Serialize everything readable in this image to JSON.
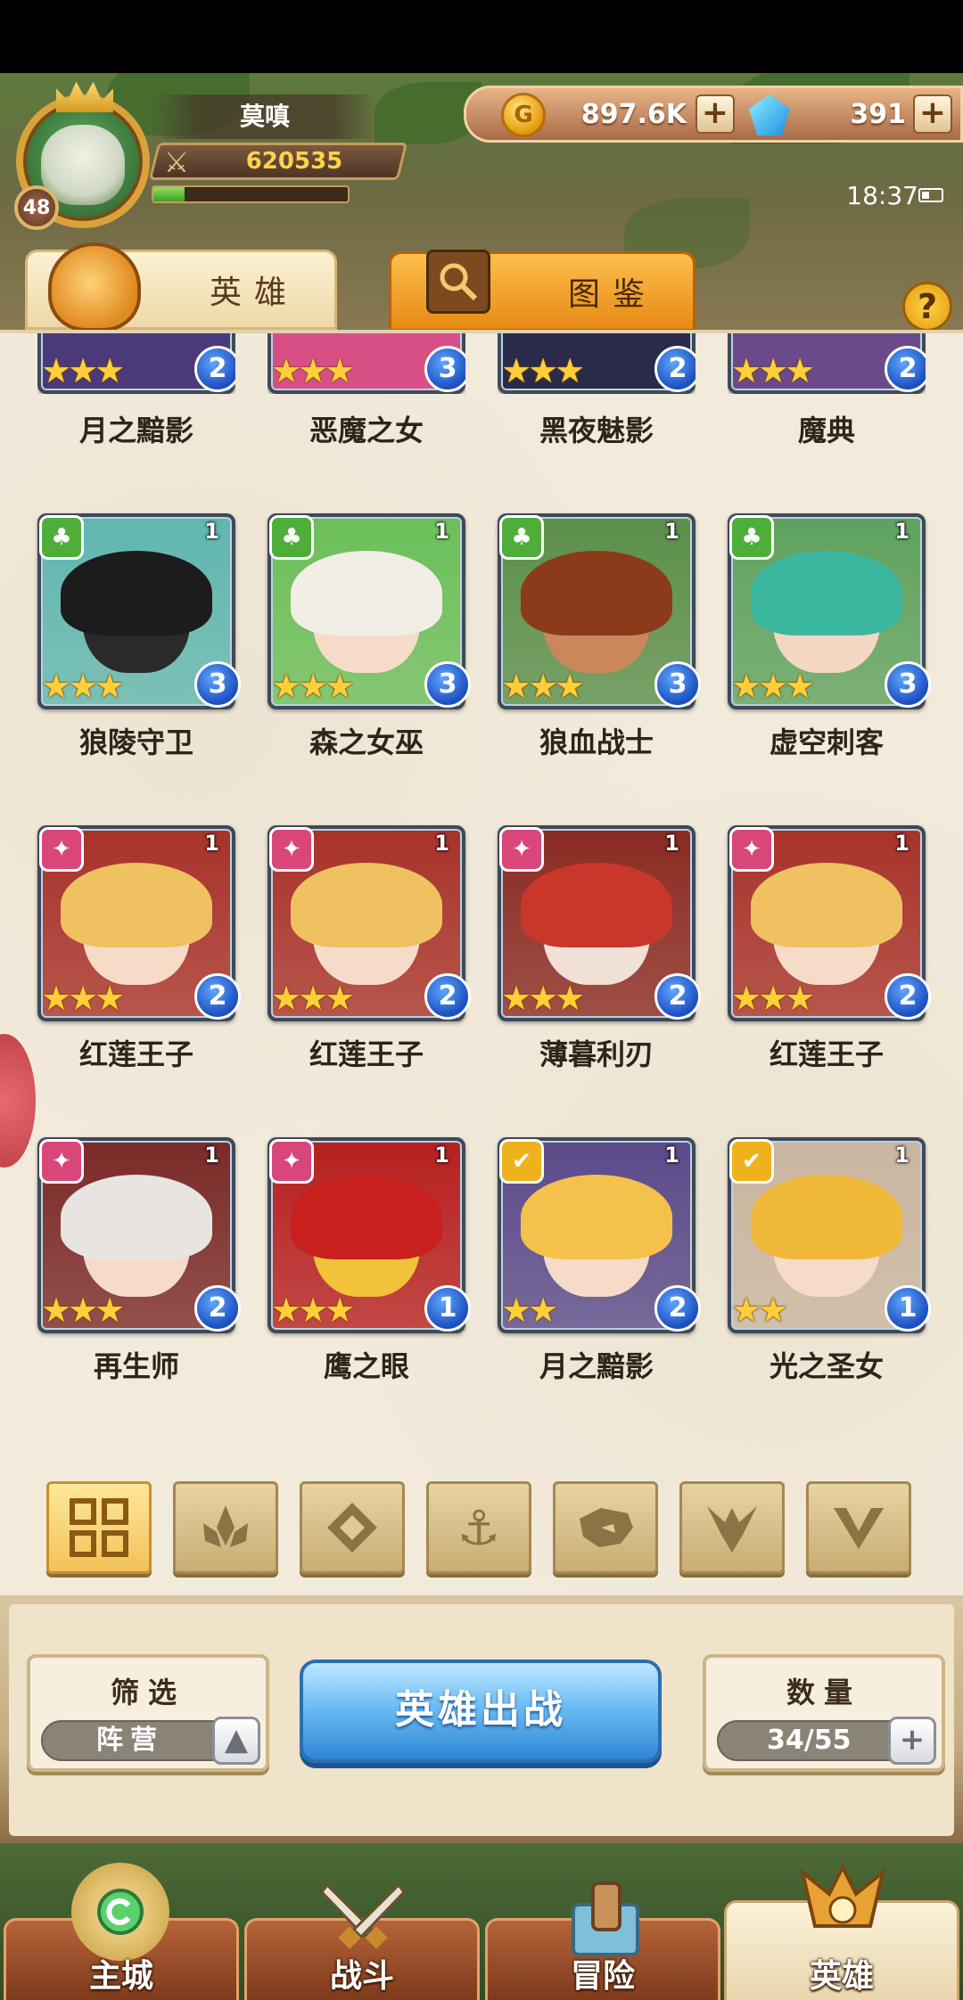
{
  "player": {
    "name": "莫嗔",
    "level": "48",
    "power": "620535",
    "exp_fraction": 0.16
  },
  "currency": {
    "gold": "897.6K",
    "gems": "391",
    "plus": "+"
  },
  "status": {
    "time": "18:37"
  },
  "tabs": {
    "heroes": "英雄",
    "codex": "图鉴"
  },
  "help": "?",
  "top_row_names": [
    "月之黯影",
    "恶魔之女",
    "黑夜魅影",
    "魔典"
  ],
  "top_row_ranks": [
    "2",
    "3",
    "2",
    "2"
  ],
  "heroes": [
    {
      "name": "狼陵守卫",
      "faction": "nature",
      "level": "1",
      "stars": 3,
      "rank": "3"
    },
    {
      "name": "森之女巫",
      "faction": "nature",
      "level": "1",
      "stars": 3,
      "rank": "3"
    },
    {
      "name": "狼血战士",
      "faction": "nature",
      "level": "1",
      "stars": 3,
      "rank": "3"
    },
    {
      "name": "虚空刺客",
      "faction": "nature",
      "level": "1",
      "stars": 3,
      "rank": "3"
    },
    {
      "name": "红莲王子",
      "faction": "fire",
      "level": "1",
      "stars": 3,
      "rank": "2"
    },
    {
      "name": "红莲王子",
      "faction": "fire",
      "level": "1",
      "stars": 3,
      "rank": "2"
    },
    {
      "name": "薄暮利刃",
      "faction": "fire",
      "level": "1",
      "stars": 3,
      "rank": "2"
    },
    {
      "name": "红莲王子",
      "faction": "fire",
      "level": "1",
      "stars": 3,
      "rank": "2"
    },
    {
      "name": "再生师",
      "faction": "fire",
      "level": "1",
      "stars": 3,
      "rank": "2"
    },
    {
      "name": "鹰之眼",
      "faction": "fire",
      "level": "1",
      "stars": 3,
      "rank": "1"
    },
    {
      "name": "月之黯影",
      "faction": "light",
      "level": "1",
      "stars": 2,
      "rank": "2"
    },
    {
      "name": "光之圣女",
      "faction": "light",
      "level": "1",
      "stars": 2,
      "rank": "1"
    }
  ],
  "filters": [
    "all-grid-icon",
    "fire-faction-icon",
    "diamond-faction-icon",
    "anchor-faction-icon",
    "beast-faction-icon",
    "dark-faction-icon",
    "light-faction-icon"
  ],
  "controls": {
    "filter_title": "筛选",
    "filter_value": "阵营",
    "deploy_label": "英雄出战",
    "count_title": "数量",
    "count_value": "34/55"
  },
  "nav": {
    "city": "主城",
    "battle": "战斗",
    "adventure": "冒险",
    "heroes": "英雄"
  }
}
